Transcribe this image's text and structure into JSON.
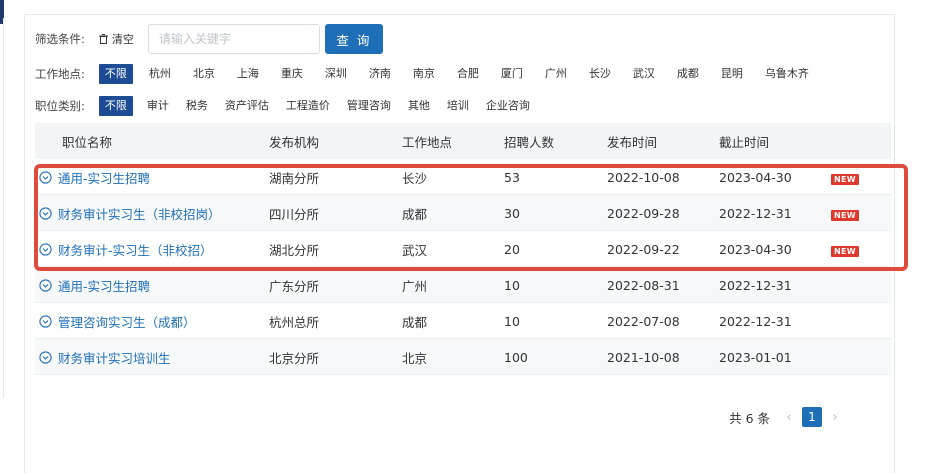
{
  "filters": {
    "condition_label": "筛选条件:",
    "clear_label": "清空",
    "search_placeholder": "请输入关键字",
    "search_value": "",
    "search_button": "查 询",
    "location_label": "工作地点:",
    "locations": [
      {
        "label": "不限",
        "active": true
      },
      {
        "label": "杭州",
        "active": false
      },
      {
        "label": "北京",
        "active": false
      },
      {
        "label": "上海",
        "active": false
      },
      {
        "label": "重庆",
        "active": false
      },
      {
        "label": "深圳",
        "active": false
      },
      {
        "label": "济南",
        "active": false
      },
      {
        "label": "南京",
        "active": false
      },
      {
        "label": "合肥",
        "active": false
      },
      {
        "label": "厦门",
        "active": false
      },
      {
        "label": "广州",
        "active": false
      },
      {
        "label": "长沙",
        "active": false
      },
      {
        "label": "武汉",
        "active": false
      },
      {
        "label": "成都",
        "active": false
      },
      {
        "label": "昆明",
        "active": false
      },
      {
        "label": "乌鲁木齐",
        "active": false
      }
    ],
    "category_label": "职位类别:",
    "categories": [
      {
        "label": "不限",
        "active": true
      },
      {
        "label": "审计",
        "active": false
      },
      {
        "label": "税务",
        "active": false
      },
      {
        "label": "资产评估",
        "active": false
      },
      {
        "label": "工程造价",
        "active": false
      },
      {
        "label": "管理咨询",
        "active": false
      },
      {
        "label": "其他",
        "active": false
      },
      {
        "label": "培训",
        "active": false
      },
      {
        "label": "企业咨询",
        "active": false
      }
    ]
  },
  "table": {
    "headers": [
      "职位名称",
      "发布机构",
      "工作地点",
      "招聘人数",
      "发布时间",
      "截止时间"
    ],
    "rows": [
      {
        "title": "通用-实习生招聘",
        "org": "湖南分所",
        "location": "长沙",
        "count": "53",
        "published": "2022-10-08",
        "deadline": "2023-04-30",
        "badge": "NEW"
      },
      {
        "title": "财务审计实习生（非校招岗）",
        "org": "四川分所",
        "location": "成都",
        "count": "30",
        "published": "2022-09-28",
        "deadline": "2022-12-31",
        "badge": "NEW"
      },
      {
        "title": "财务审计-实习生（非校招）",
        "org": "湖北分所",
        "location": "武汉",
        "count": "20",
        "published": "2022-09-22",
        "deadline": "2023-04-30",
        "badge": "NEW"
      },
      {
        "title": "通用-实习生招聘",
        "org": "广东分所",
        "location": "广州",
        "count": "10",
        "published": "2022-08-31",
        "deadline": "2022-12-31",
        "badge": ""
      },
      {
        "title": "管理咨询实习生（成都）",
        "org": "杭州总所",
        "location": "成都",
        "count": "10",
        "published": "2022-07-08",
        "deadline": "2022-12-31",
        "badge": ""
      },
      {
        "title": "财务审计实习培训生",
        "org": "北京分所",
        "location": "北京",
        "count": "100",
        "published": "2021-10-08",
        "deadline": "2023-01-01",
        "badge": ""
      }
    ]
  },
  "pagination": {
    "total": "共 6 条",
    "prev": "‹",
    "current_page": "1",
    "next": "›"
  },
  "colors": {
    "accent": "#1f6fb8",
    "active_tag": "#1d4b94",
    "new_badge": "#e03a2f",
    "highlight_border": "#dd4b3c"
  },
  "icons": {
    "clear": "trash-icon",
    "row": "circle-chevron-down-icon"
  }
}
